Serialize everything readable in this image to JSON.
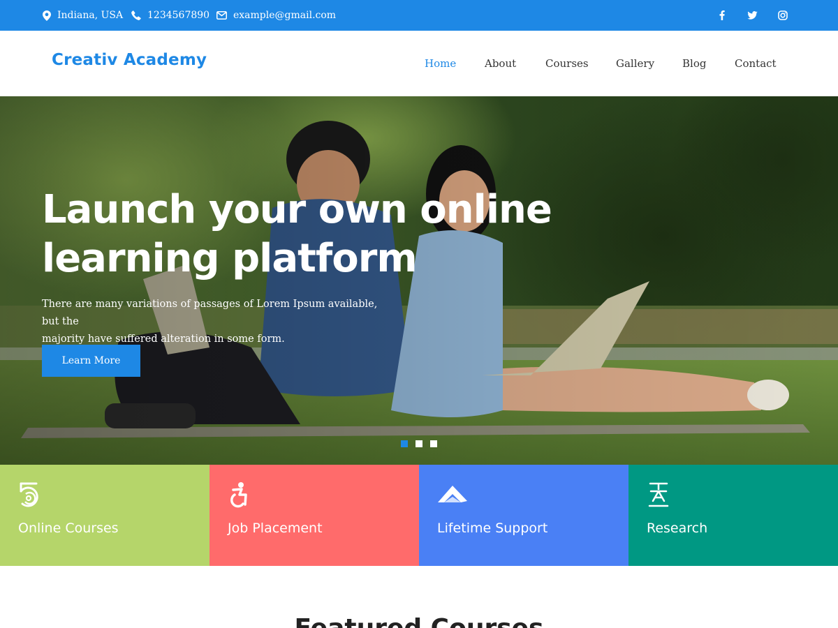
{
  "topbar": {
    "location": "Indiana, USA",
    "phone": "1234567890",
    "email": "example@gmail.com",
    "social": [
      "facebook-icon",
      "twitter-icon",
      "instagram-icon"
    ],
    "bg_color": "#1e88e5"
  },
  "header": {
    "logo": "Creativ Academy",
    "nav": [
      {
        "label": "Home",
        "active": true
      },
      {
        "label": "About",
        "active": false
      },
      {
        "label": "Courses",
        "active": false
      },
      {
        "label": "Gallery",
        "active": false
      },
      {
        "label": "Blog",
        "active": false
      },
      {
        "label": "Contact",
        "active": false
      }
    ]
  },
  "hero": {
    "title_line1": "Launch your own online",
    "title_line2": "learning platform",
    "text_line1": "There are many variations of passages of Lorem Ipsum available, but the",
    "text_line2": "majority have suffered alteration in some form.",
    "button": "Learn More",
    "slides": 3,
    "active_slide": 1
  },
  "features": [
    {
      "label": "Online Courses",
      "icon": "five-spiral-icon",
      "color": "#b5d56a"
    },
    {
      "label": "Job Placement",
      "icon": "accessible-icon",
      "color": "#ff6b6b"
    },
    {
      "label": "Lifetime Support",
      "icon": "paper-plane-icon",
      "color": "#4a80f5"
    },
    {
      "label": "Research",
      "icon": "text-width-icon",
      "color": "#009883"
    }
  ],
  "featured": {
    "heading": "Featured Courses"
  },
  "colors": {
    "accent": "#1e88e5"
  }
}
